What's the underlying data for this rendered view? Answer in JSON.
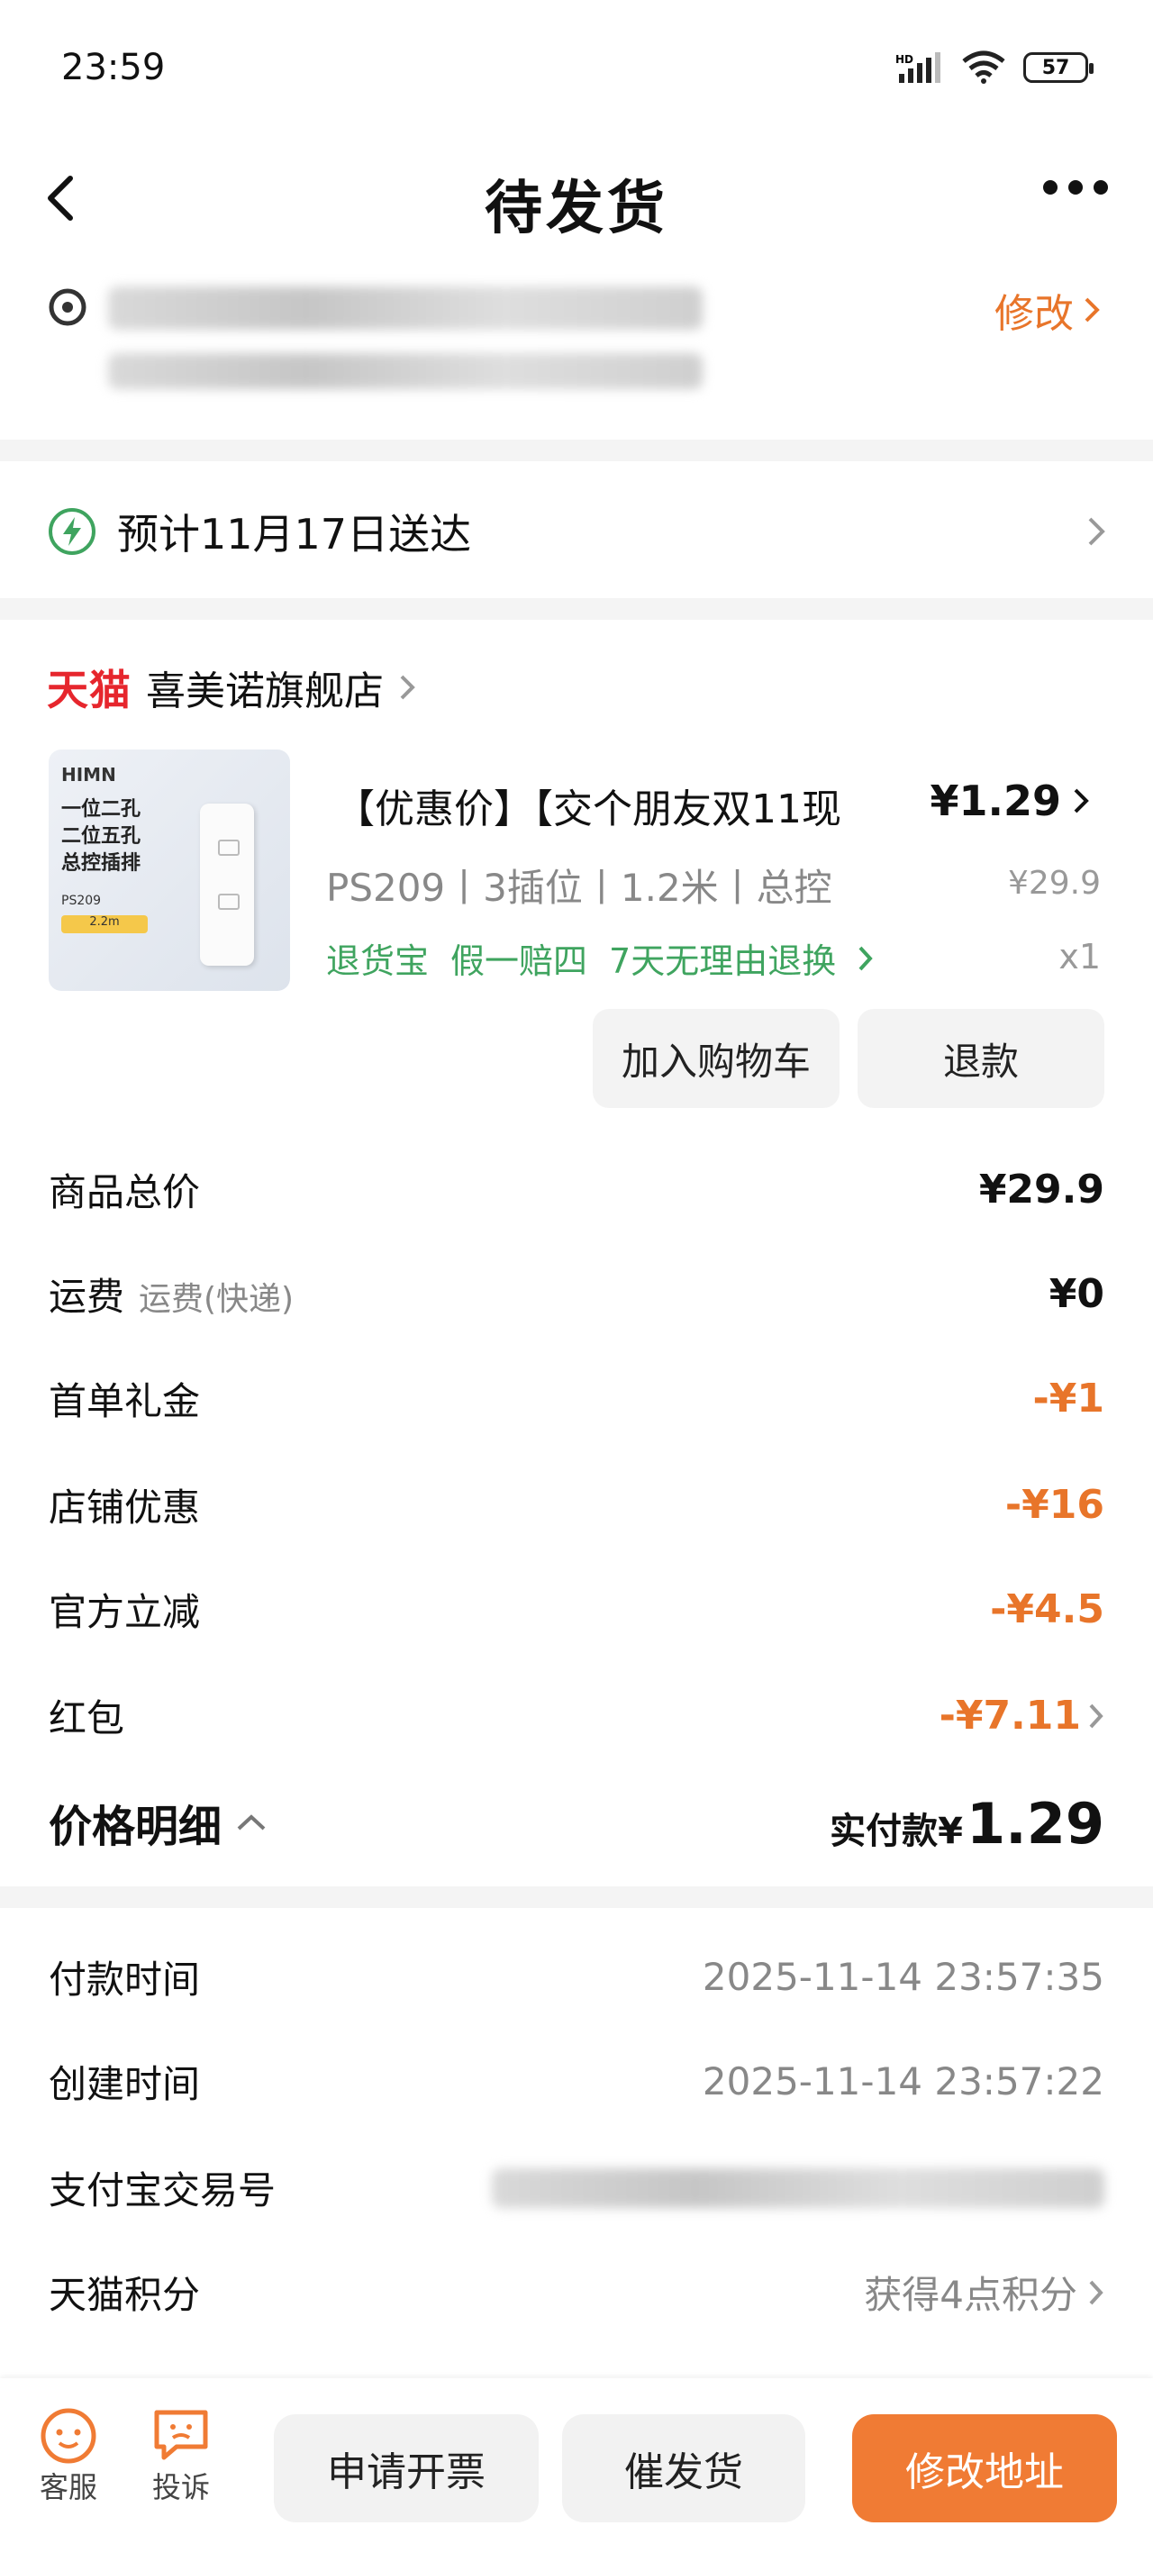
{
  "status_bar": {
    "time": "23:59",
    "battery": "57"
  },
  "nav": {
    "title": "待发货"
  },
  "address": {
    "edit_label": "修改"
  },
  "delivery": {
    "text": "预计11月17日送达"
  },
  "store": {
    "platform": "天猫",
    "name": "喜美诺旗舰店"
  },
  "product": {
    "image_brand": "HIMN",
    "image_text": "一位二孔\n二位五孔\n总控插排",
    "image_model": "PS209",
    "image_badge": "2.2m",
    "title": "【优惠价】【交个朋友双11现",
    "price": "¥1.29",
    "spec": "PS209丨3插位丨1.2米丨总控",
    "original_price": "¥29.9",
    "services": [
      "退货宝",
      "假一赔四",
      "7天无理由退换"
    ],
    "quantity": "x1",
    "add_cart_label": "加入购物车",
    "refund_label": "退款"
  },
  "price_rows": [
    {
      "label": "商品总价",
      "sub": "",
      "value": "¥29.9"
    },
    {
      "label": "运费",
      "sub": "运费(快递)",
      "value": "¥0"
    },
    {
      "label": "首单礼金",
      "sub": "",
      "value": "-¥1"
    },
    {
      "label": "店铺优惠",
      "sub": "",
      "value": "-¥16"
    },
    {
      "label": "官方立减",
      "sub": "",
      "value": "-¥4.5"
    },
    {
      "label": "红包",
      "sub": "",
      "value": "-¥7.11"
    }
  ],
  "price_detail": {
    "title": "价格明细",
    "paid_label": "实付款¥",
    "paid_amount": "1.29"
  },
  "info_rows": [
    {
      "label": "付款时间",
      "value": "2025-11-14 23:57:35"
    },
    {
      "label": "创建时间",
      "value": "2025-11-14 23:57:22"
    },
    {
      "label": "支付宝交易号",
      "value": ""
    },
    {
      "label": "天猫积分",
      "value": "获得4点积分"
    }
  ],
  "bottom_bar": {
    "service_label": "客服",
    "complaint_label": "投诉",
    "invoice_label": "申请开票",
    "urge_label": "催发货",
    "change_address_label": "修改地址"
  },
  "colors": {
    "accent_orange": "#e8752a",
    "button_orange": "#f07b34",
    "service_green": "#3fa45f",
    "tmall_red": "#e6262d"
  }
}
